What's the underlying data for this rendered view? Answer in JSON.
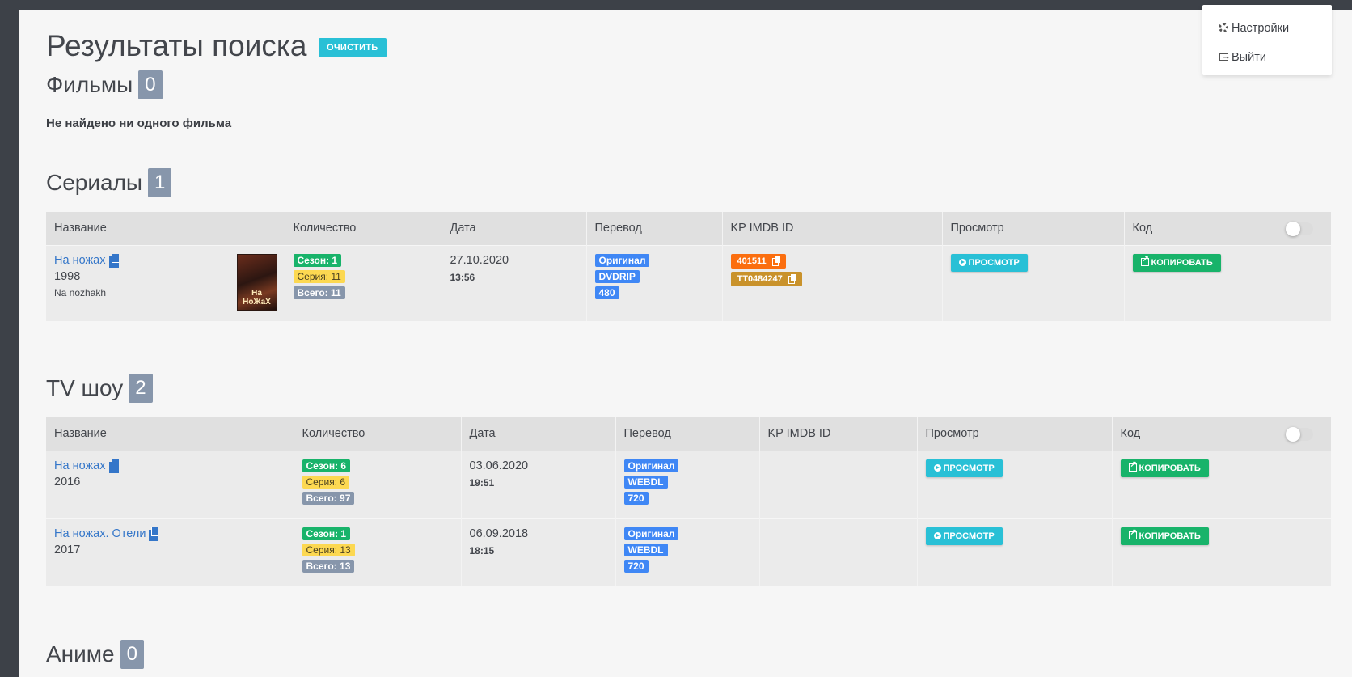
{
  "page": {
    "title": "Результаты поиска",
    "clear_label": "ОЧИСТИТЬ"
  },
  "user_menu": {
    "settings_label": "Настройки",
    "logout_label": "Выйти"
  },
  "sections": {
    "films": {
      "title": "Фильмы",
      "count": "0",
      "empty_message": "Не найдено ни одного фильма"
    },
    "series": {
      "title": "Сериалы",
      "count": "1"
    },
    "tvshow": {
      "title": "TV шоу",
      "count": "2"
    },
    "anime": {
      "title": "Аниме",
      "count": "0"
    }
  },
  "columns": {
    "name": "Название",
    "count": "Количество",
    "date": "Дата",
    "translation": "Перевод",
    "ids": "KP IMDB ID",
    "view": "Просмотр",
    "code": "Код"
  },
  "buttons": {
    "view": "ПРОСМОТР",
    "copy": "КОПИРОВАТЬ"
  },
  "series_rows": [
    {
      "title": "На ножах",
      "year": "1998",
      "original_title": "Na nozhakh",
      "poster_text": "На НоЖаХ",
      "season": "Сезон: 1",
      "episode": "Серия: 11",
      "total": "Всего: 11",
      "date": "27.10.2020",
      "time": "13:56",
      "translation": [
        "Оригинал",
        "DVDRIP",
        "480"
      ],
      "kp_id": "401511",
      "imdb_id": "TT0484247"
    }
  ],
  "tvshow_rows": [
    {
      "title": "На ножах",
      "year": "2016",
      "season": "Сезон: 6",
      "episode": "Серия: 6",
      "total": "Всего: 97",
      "date": "03.06.2020",
      "time": "19:51",
      "translation": [
        "Оригинал",
        "WEBDL",
        "720"
      ]
    },
    {
      "title": "На ножах. Отели",
      "year": "2017",
      "season": "Сезон: 1",
      "episode": "Серия: 13",
      "total": "Всего: 13",
      "date": "06.09.2018",
      "time": "18:15",
      "translation": [
        "Оригинал",
        "WEBDL",
        "720"
      ]
    }
  ],
  "colors": {
    "accent_cyan": "#29c0d6",
    "green": "#18b36a",
    "yellow": "#fcd851",
    "gray_badge": "#8796ab",
    "blue_badge": "#3f87f5",
    "orange": "#fb6e0f",
    "brown": "#c9922b",
    "link": "#3476c9"
  }
}
